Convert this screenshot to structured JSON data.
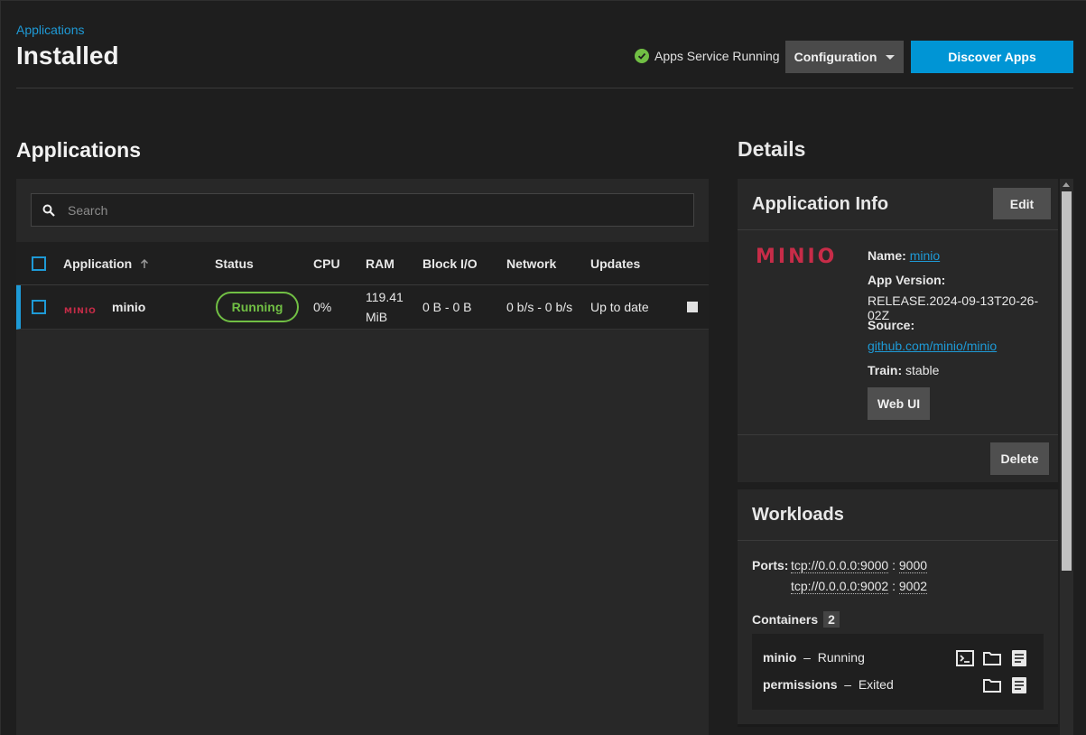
{
  "header": {
    "breadcrumb": "Applications",
    "title": "Installed",
    "service_status": "Apps Service Running",
    "configuration_label": "Configuration",
    "discover_label": "Discover Apps"
  },
  "applications": {
    "title": "Applications",
    "search_placeholder": "Search",
    "columns": [
      "Application",
      "Status",
      "CPU",
      "RAM",
      "Block I/O",
      "Network",
      "Updates"
    ],
    "rows": [
      {
        "name": "minio",
        "status": "Running",
        "cpu": "0%",
        "ram_value": "119.41",
        "ram_unit": "MiB",
        "block_io": "0 B - 0 B",
        "network": "0 b/s - 0 b/s",
        "updates": "Up to date"
      }
    ]
  },
  "details": {
    "title": "Details",
    "app_info": {
      "title": "Application Info",
      "edit_label": "Edit",
      "name_label": "Name:",
      "name_value": "minio",
      "version_label": "App Version:",
      "version_value": "RELEASE.2024-09-13T20-26-02Z",
      "source_label": "Source:",
      "source_value": "github.com/minio/minio",
      "train_label": "Train:",
      "train_value": "stable",
      "webui_label": "Web UI",
      "delete_label": "Delete"
    },
    "workloads": {
      "title": "Workloads",
      "ports_label": "Ports:",
      "ports": [
        {
          "host": "tcp://0.0.0.0:9000",
          "sep": ":",
          "container": "9000"
        },
        {
          "host": "tcp://0.0.0.0:9002",
          "sep": ":",
          "container": "9002"
        }
      ],
      "containers_label": "Containers",
      "containers_count": "2",
      "containers": [
        {
          "name": "minio",
          "dash": "–",
          "state": "Running"
        },
        {
          "name": "permissions",
          "dash": "–",
          "state": "Exited"
        }
      ]
    }
  },
  "logo_text": "MINIO",
  "colors": {
    "accent": "#0095d5",
    "running": "#71bf44",
    "minio_red": "#c72c48",
    "background": "#1e1e1e",
    "panel": "#282828"
  }
}
